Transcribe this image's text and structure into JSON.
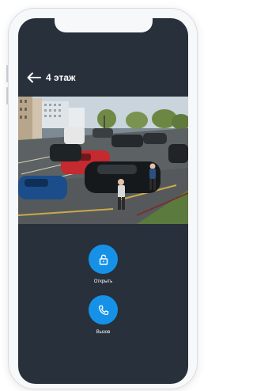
{
  "header": {
    "back_icon": "arrow-left-icon",
    "title": "4 этаж"
  },
  "camera_feed": {
    "description_icon": "camera-view"
  },
  "actions": {
    "open": {
      "label": "Открыть",
      "icon": "unlock-icon",
      "color": "#1592e8"
    },
    "call": {
      "label": "Вызов",
      "icon": "phone-icon",
      "color": "#1592e8"
    }
  },
  "colors": {
    "screen_background": "#27303b",
    "accent": "#1592e8",
    "text": "#ffffff"
  }
}
